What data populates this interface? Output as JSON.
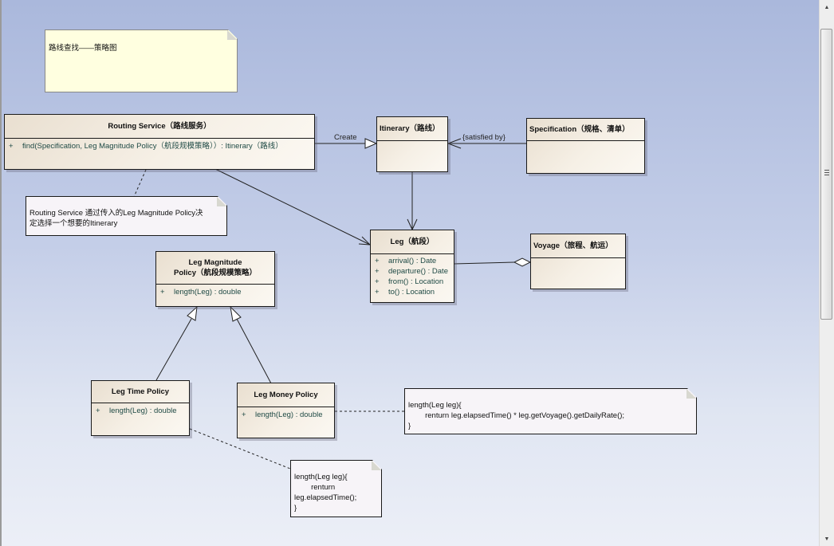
{
  "title_note": {
    "text": "路线查找——策略图"
  },
  "classes": {
    "routing_service": {
      "name": "Routing Service（路线服务）",
      "operations": [
        {
          "visibility": "+",
          "signature": "find(Specification, Leg Magnitude Policy（航段规模策略））: Itinerary（路线）"
        }
      ]
    },
    "itinerary": {
      "name": "Itinerary（路线）",
      "operations": []
    },
    "specification": {
      "name": "Specification（规格、清单）",
      "operations": []
    },
    "leg": {
      "name": "Leg（航段）",
      "operations": [
        {
          "visibility": "+",
          "signature": "arrival() : Date"
        },
        {
          "visibility": "+",
          "signature": "departure() : Date"
        },
        {
          "visibility": "+",
          "signature": "from() : Location"
        },
        {
          "visibility": "+",
          "signature": "to() : Location"
        }
      ]
    },
    "voyage": {
      "name": "Voyage（旅程、航运）",
      "operations": []
    },
    "leg_magnitude_policy": {
      "name_line1": "Leg Magnitude",
      "name_line2": "Policy（航段规模策略）",
      "operations": [
        {
          "visibility": "+",
          "signature": "length(Leg) : double"
        }
      ]
    },
    "leg_time_policy": {
      "name": "Leg Time Policy",
      "operations": [
        {
          "visibility": "+",
          "signature": "length(Leg) : double"
        }
      ]
    },
    "leg_money_policy": {
      "name": "Leg Money Policy",
      "operations": [
        {
          "visibility": "+",
          "signature": "length(Leg) : double"
        }
      ]
    }
  },
  "notes": {
    "routing_note": {
      "line1": "Routing Service 通过传入的Leg Magnitude Policy决",
      "line2": "定选择一个想要的Itinerary"
    },
    "money_code": {
      "line1": "length(Leg leg){",
      "line2": "        renturn leg.elapsedTime() * leg.getVoyage().getDailyRate();",
      "line3": "}"
    },
    "time_code": {
      "line1": "length(Leg leg){",
      "line2": "        renturn",
      "line3": "leg.elapsedTime();",
      "line4": "}"
    }
  },
  "connector_labels": {
    "create": "Create",
    "satisfied_by": "{satisfied by}"
  },
  "scrollbar": {
    "up_icon": "▲",
    "down_icon": "▼"
  }
}
